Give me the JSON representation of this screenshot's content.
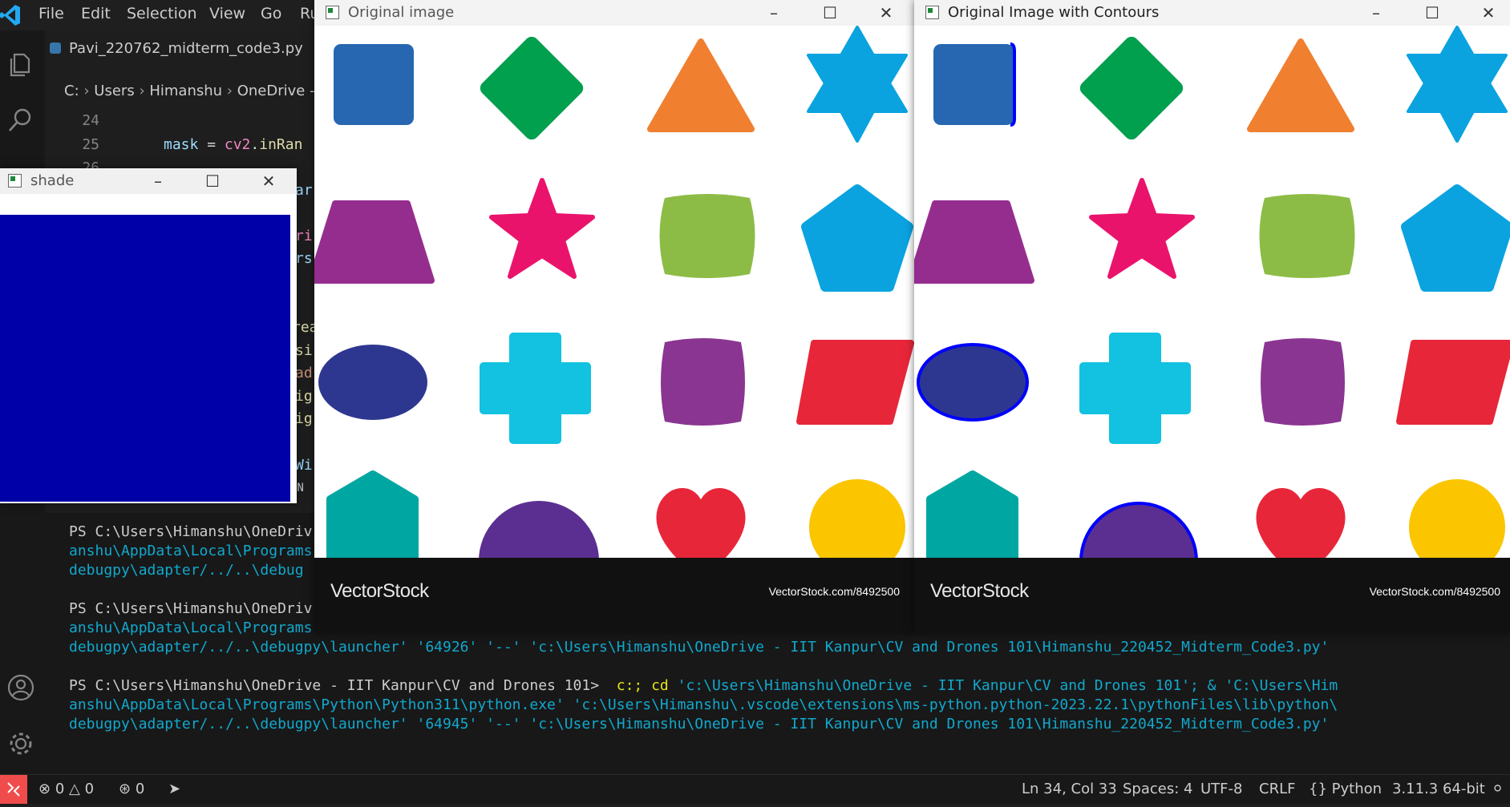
{
  "menubar": {
    "items": [
      "File",
      "Edit",
      "Selection",
      "View",
      "Go",
      "Ru"
    ]
  },
  "editor": {
    "tab_label": "Pavi_220762_midterm_code3.py",
    "breadcrumb": [
      "C:",
      "Users",
      "Himanshu",
      "OneDrive -"
    ],
    "lines": [
      {
        "num": "24",
        "text": ""
      },
      {
        "num": "25",
        "parts": [
          "mask",
          " = ",
          "cv2",
          ".",
          "inRan"
        ]
      },
      {
        "num": "26",
        "text": ""
      }
    ],
    "fragments": [
      "ar",
      "ri",
      "rs",
      "rea",
      "si",
      "ad",
      "ig",
      "ig",
      "Wi",
      "ON"
    ]
  },
  "terminal": {
    "lines": [
      {
        "ps": "PS C:\\Users\\Himanshu\\OneDriv",
        "rest": ""
      },
      {
        "ps": "",
        "rest": "anshu\\AppData\\Local\\Programs"
      },
      {
        "ps": "",
        "rest": "debugpy\\adapter/../..\\debug"
      },
      {
        "ps": "PS C:\\Users\\Himanshu\\OneDriv",
        "rest": ""
      },
      {
        "ps": "",
        "rest": "anshu\\AppData\\Local\\Programs"
      },
      {
        "ps": "",
        "rest": "debugpy\\adapter/../..\\debugpy\\launcher' '64926' '--' 'c:\\Users\\Himanshu\\OneDrive - IIT Kanpur\\CV and Drones 101\\Himanshu_220452_Midterm_Code3.py'"
      },
      {
        "ps": "PS C:\\Users\\Himanshu\\OneDrive - IIT Kanpur\\CV and Drones 101>",
        "cmd1": "  c:; ",
        "cmd2": "cd ",
        "rest": "'c:\\Users\\Himanshu\\OneDrive - IIT Kanpur\\CV and Drones 101'; & 'C:\\Users\\Him"
      },
      {
        "ps": "",
        "rest": "anshu\\AppData\\Local\\Programs\\Python\\Python311\\python.exe' 'c:\\Users\\Himanshu\\.vscode\\extensions\\ms-python.python-2023.22.1\\pythonFiles\\lib\\python\\"
      },
      {
        "ps": "",
        "rest": "debugpy\\adapter/../..\\debugpy\\launcher' '64945' '--' 'c:\\Users\\Himanshu\\OneDrive - IIT Kanpur\\CV and Drones 101\\Himanshu_220452_Midterm_Code3.py'"
      }
    ]
  },
  "statusbar": {
    "errors": "0",
    "warnings": "0",
    "ports": "0",
    "position": "Ln 34, Col 33",
    "spaces": "Spaces: 4",
    "encoding": "UTF-8",
    "eol": "CRLF",
    "language": "Python",
    "interpreter": "3.11.3 64-bit"
  },
  "windows": {
    "shade": {
      "title": "shade",
      "fill_color": "#0000a8"
    },
    "original": {
      "title": "Original image"
    },
    "contours": {
      "title": "Original Image with Contours",
      "contour_color": "#0000ff"
    }
  },
  "image": {
    "brand": "VectorStock",
    "url": "VectorStock.com/8492500",
    "shapes": [
      {
        "name": "square",
        "color": "#2766b0"
      },
      {
        "name": "diamond",
        "color": "#00a04e"
      },
      {
        "name": "triangle",
        "color": "#f07f30"
      },
      {
        "name": "star-six",
        "color": "#0aa3e0"
      },
      {
        "name": "trapezoid",
        "color": "#952d8f"
      },
      {
        "name": "star-five",
        "color": "#ea136c"
      },
      {
        "name": "rounded-rect",
        "color": "#8dbc46"
      },
      {
        "name": "pentagon",
        "color": "#0aa3e0"
      },
      {
        "name": "ellipse",
        "color": "#2e3790"
      },
      {
        "name": "cross",
        "color": "#12c2e0"
      },
      {
        "name": "rounded-square",
        "color": "#8a3592"
      },
      {
        "name": "parallelogram",
        "color": "#e8263a"
      },
      {
        "name": "hexagon",
        "color": "#00a7a2"
      },
      {
        "name": "semicircle",
        "color": "#5b2f91"
      },
      {
        "name": "heart",
        "color": "#e8263a"
      },
      {
        "name": "circle",
        "color": "#fbc500"
      }
    ]
  }
}
